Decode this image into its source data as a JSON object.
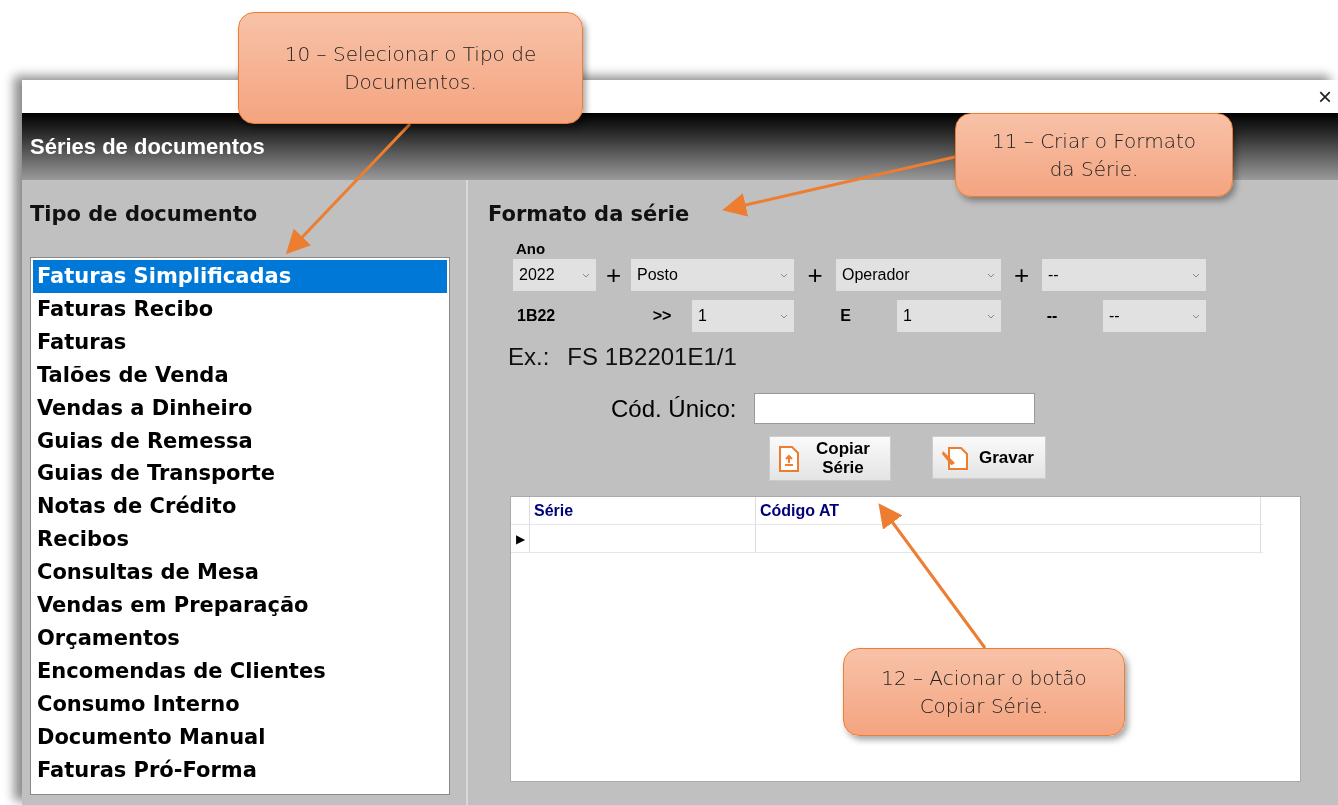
{
  "window": {
    "title": "Séries de documentos",
    "close": "×"
  },
  "document_types": {
    "heading": "Tipo de documento",
    "items": [
      {
        "label": "Faturas Simplificadas",
        "selected": true
      },
      {
        "label": "Faturas Recibo",
        "selected": false
      },
      {
        "label": "Faturas",
        "selected": false
      },
      {
        "label": "Talões de Venda",
        "selected": false
      },
      {
        "label": "Vendas a Dinheiro",
        "selected": false
      },
      {
        "label": "Guias de Remessa",
        "selected": false
      },
      {
        "label": "Guias de Transporte",
        "selected": false
      },
      {
        "label": "Notas de Crédito",
        "selected": false
      },
      {
        "label": "Recibos",
        "selected": false
      },
      {
        "label": "Consultas de Mesa",
        "selected": false
      },
      {
        "label": "Vendas em Preparação",
        "selected": false
      },
      {
        "label": "Orçamentos",
        "selected": false
      },
      {
        "label": "Encomendas de Clientes",
        "selected": false
      },
      {
        "label": "Consumo Interno",
        "selected": false
      },
      {
        "label": "Documento Manual",
        "selected": false
      },
      {
        "label": "Faturas Pró-Forma",
        "selected": false
      }
    ]
  },
  "series_format": {
    "heading": "Formato da série",
    "year_label": "Ano",
    "row_1": [
      {
        "kind": "select",
        "value": "2022"
      },
      {
        "kind": "symbol",
        "text": "+"
      },
      {
        "kind": "select",
        "value": "Posto"
      },
      {
        "kind": "symbol",
        "text": "+"
      },
      {
        "kind": "select",
        "value": "Operador"
      },
      {
        "kind": "symbol",
        "text": "+"
      },
      {
        "kind": "select",
        "value": "--"
      }
    ],
    "row_2": [
      {
        "kind": "label",
        "text": "1B22"
      },
      {
        "kind": "label",
        "text": ">>"
      },
      {
        "kind": "select",
        "value": "1"
      },
      {
        "kind": "label",
        "text": "E"
      },
      {
        "kind": "select",
        "value": "1"
      },
      {
        "kind": "label",
        "text": "--"
      },
      {
        "kind": "select",
        "value": "--"
      }
    ],
    "example_label": "Ex.:",
    "example_value": "FS 1B2201E1/1",
    "unique_code_label": "Cód. Único:",
    "buttons": [
      {
        "kind": "copy",
        "label": "Copiar Série"
      },
      {
        "kind": "save",
        "label": "Gravar"
      }
    ],
    "table": {
      "columns": [
        "Série",
        "Código AT"
      ],
      "row_marker": "▶"
    }
  },
  "callouts": [
    "10 – Selecionar o Tipo de Documentos.",
    "11 – Criar o Formato da Série.",
    "12 – Acionar o botão Copiar Série."
  ]
}
